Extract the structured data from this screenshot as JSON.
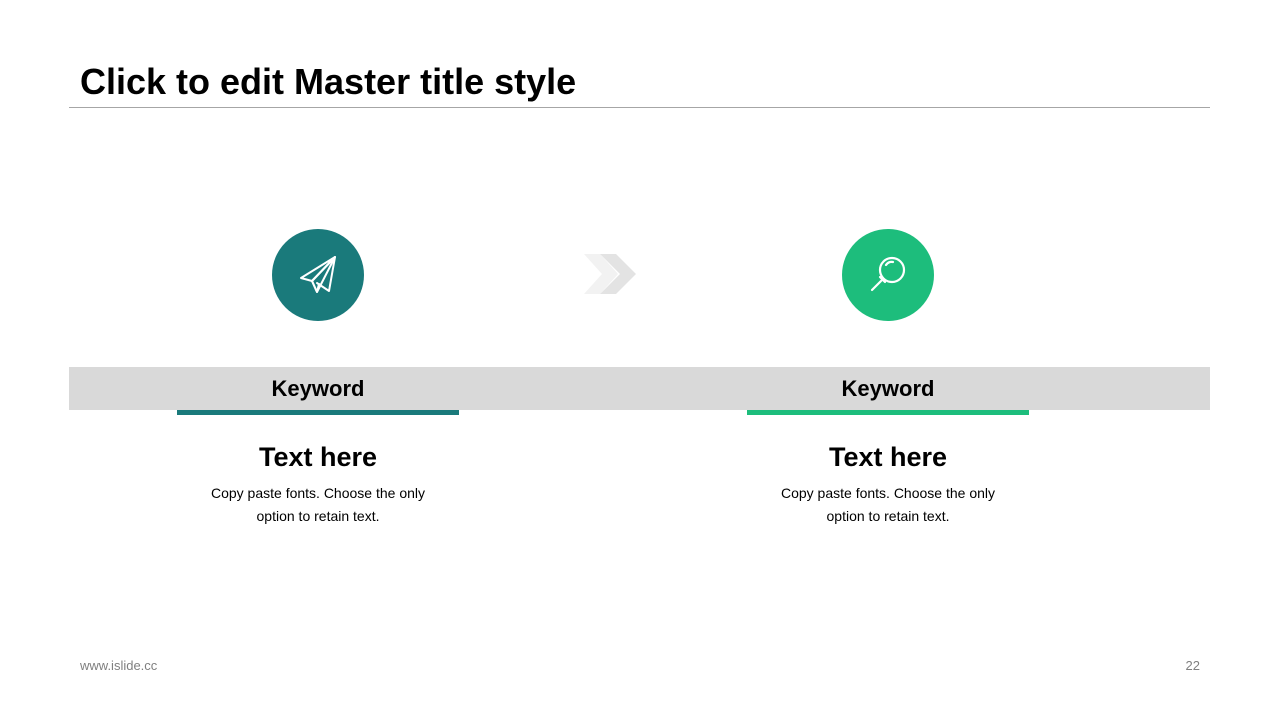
{
  "slide": {
    "title": "Click to edit Master title style",
    "footer_url": "www.islide.cc",
    "page_number": "22"
  },
  "colors": {
    "teal": "#1a7a7b",
    "green": "#1dbd7c",
    "band": "#d9d9d9",
    "chevron": "#e6e6e6"
  },
  "steps": [
    {
      "icon": "paper-plane-icon",
      "keyword": "Keyword",
      "heading": "Text here",
      "description": "Copy paste fonts. Choose the only option to retain text."
    },
    {
      "icon": "magnifier-icon",
      "keyword": "Keyword",
      "heading": "Text here",
      "description": "Copy paste fonts. Choose the only option to retain text."
    }
  ]
}
